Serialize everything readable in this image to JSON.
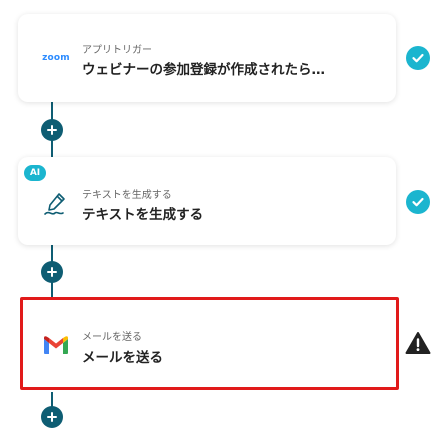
{
  "flow": {
    "steps": [
      {
        "app": "zoom",
        "icon": "zoom-logo-icon",
        "subtitle": "アプリトリガー",
        "title": "ウェビナーの参加登録が作成されたら…",
        "status": "complete"
      },
      {
        "app": "ai",
        "icon": "pen-sign-icon",
        "badge": "AI",
        "subtitle": "テキストを生成する",
        "title": "テキストを生成する",
        "status": "complete"
      },
      {
        "app": "gmail",
        "icon": "gmail-logo-icon",
        "subtitle": "メールを送る",
        "title": "メールを送る",
        "status": "warning",
        "selected": true
      }
    ]
  },
  "colors": {
    "connector": "#0e5d73",
    "check": "#1bb5cf",
    "selection_border": "#e11a1a",
    "warning": "#222222"
  }
}
